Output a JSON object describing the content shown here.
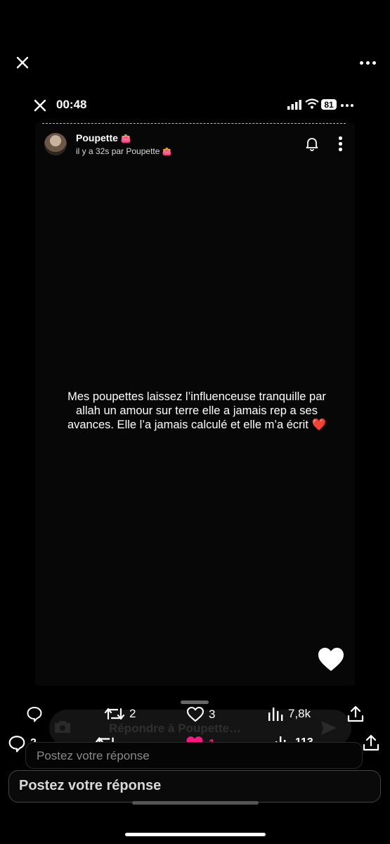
{
  "outer": {
    "close_icon": "close-icon",
    "more_icon": "more-dots-icon"
  },
  "story": {
    "time": "00:48",
    "battery": "81",
    "author": {
      "name": "Poupette",
      "subtitle": "il y a 32s par Poupette",
      "badge_emoji": "👛"
    },
    "message_line1": "Mes poupettes laissez l’influenceuse tranquille par",
    "message_line2": "allah un amour sur terre elle a jamais rep a ses",
    "message_line3": "avances.  Elle l’a jamais calculé et elle m’a écrit ❤️",
    "reply_placeholder": "Répondre à Poupette…"
  },
  "tweet_actions_inner": {
    "reply_count": "",
    "retweet_count": "2",
    "like_count": "3",
    "views_count": "7,8k"
  },
  "tweet_actions_outer": {
    "reply_count": "2",
    "retweet_count": "",
    "like_count": "1",
    "views_count": "113"
  },
  "reply_inputs": {
    "inner_placeholder": "Postez votre réponse",
    "outer_placeholder": "Postez votre réponse"
  },
  "colors": {
    "like_pink": "#f91880",
    "background": "#000000"
  }
}
